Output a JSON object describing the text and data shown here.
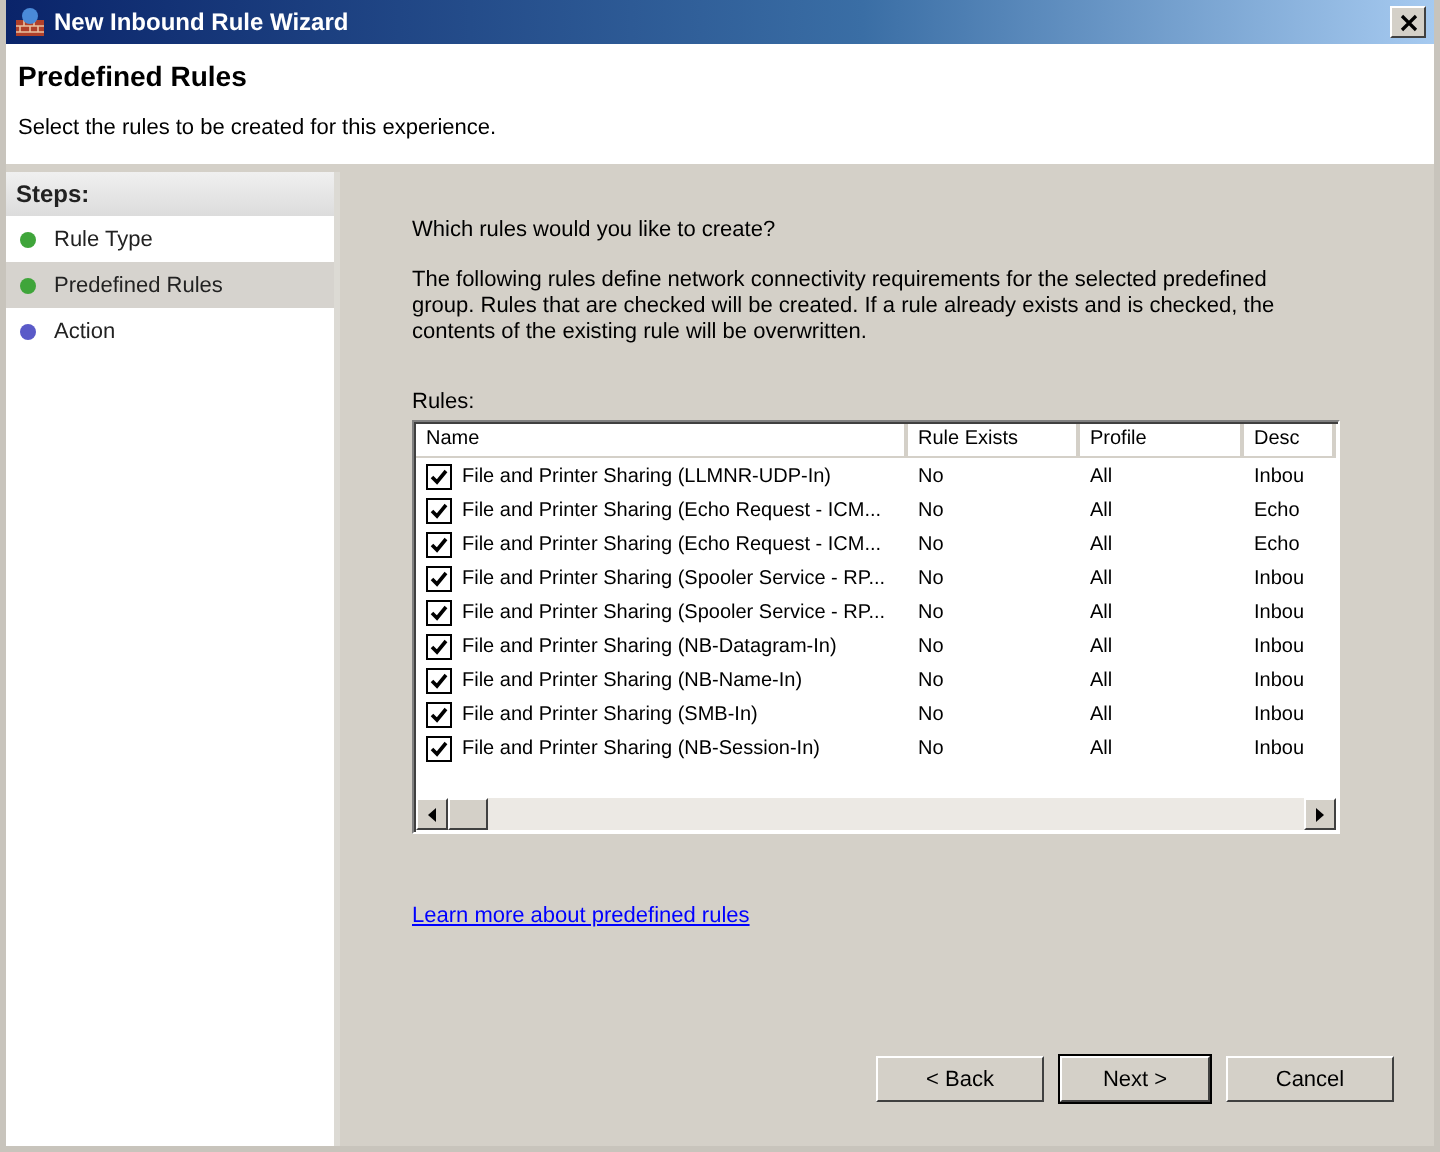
{
  "window": {
    "title": "New Inbound Rule Wizard"
  },
  "header": {
    "title": "Predefined Rules",
    "subtitle": "Select the rules to be created for this experience."
  },
  "steps": {
    "title": "Steps:",
    "items": [
      {
        "label": "Rule Type",
        "selected": false,
        "color": "#3fa53a"
      },
      {
        "label": "Predefined Rules",
        "selected": true,
        "color": "#3fa53a"
      },
      {
        "label": "Action",
        "selected": false,
        "color": "#5a5ac8"
      }
    ]
  },
  "question": "Which rules would you like to create?",
  "description": "The following rules define network connectivity requirements for the selected predefined group. Rules that are checked will be created. If a rule already exists and is checked, the contents of the existing rule will be overwritten.",
  "rules": {
    "label": "Rules:",
    "columns": [
      "Name",
      "Rule Exists",
      "Profile",
      "Desc"
    ],
    "rows": [
      {
        "checked": true,
        "cells": [
          "File and Printer Sharing (LLMNR-UDP-In)",
          "No",
          "All",
          "Inbou"
        ]
      },
      {
        "checked": true,
        "cells": [
          "File and Printer Sharing (Echo Request - ICM...",
          "No",
          "All",
          "Echo"
        ]
      },
      {
        "checked": true,
        "cells": [
          "File and Printer Sharing (Echo Request - ICM...",
          "No",
          "All",
          "Echo"
        ]
      },
      {
        "checked": true,
        "cells": [
          "File and Printer Sharing (Spooler Service - RP...",
          "No",
          "All",
          "Inbou"
        ]
      },
      {
        "checked": true,
        "cells": [
          "File and Printer Sharing (Spooler Service - RP...",
          "No",
          "All",
          "Inbou"
        ]
      },
      {
        "checked": true,
        "cells": [
          "File and Printer Sharing (NB-Datagram-In)",
          "No",
          "All",
          "Inbou"
        ]
      },
      {
        "checked": true,
        "cells": [
          "File and Printer Sharing (NB-Name-In)",
          "No",
          "All",
          "Inbou"
        ]
      },
      {
        "checked": true,
        "cells": [
          "File and Printer Sharing (SMB-In)",
          "No",
          "All",
          "Inbou"
        ]
      },
      {
        "checked": true,
        "cells": [
          "File and Printer Sharing (NB-Session-In)",
          "No",
          "All",
          "Inbou"
        ]
      }
    ]
  },
  "link": "Learn more about predefined rules",
  "buttons": [
    {
      "label": "< Back",
      "default": false
    },
    {
      "label": "Next >",
      "default": true
    },
    {
      "label": "Cancel",
      "default": false
    }
  ]
}
